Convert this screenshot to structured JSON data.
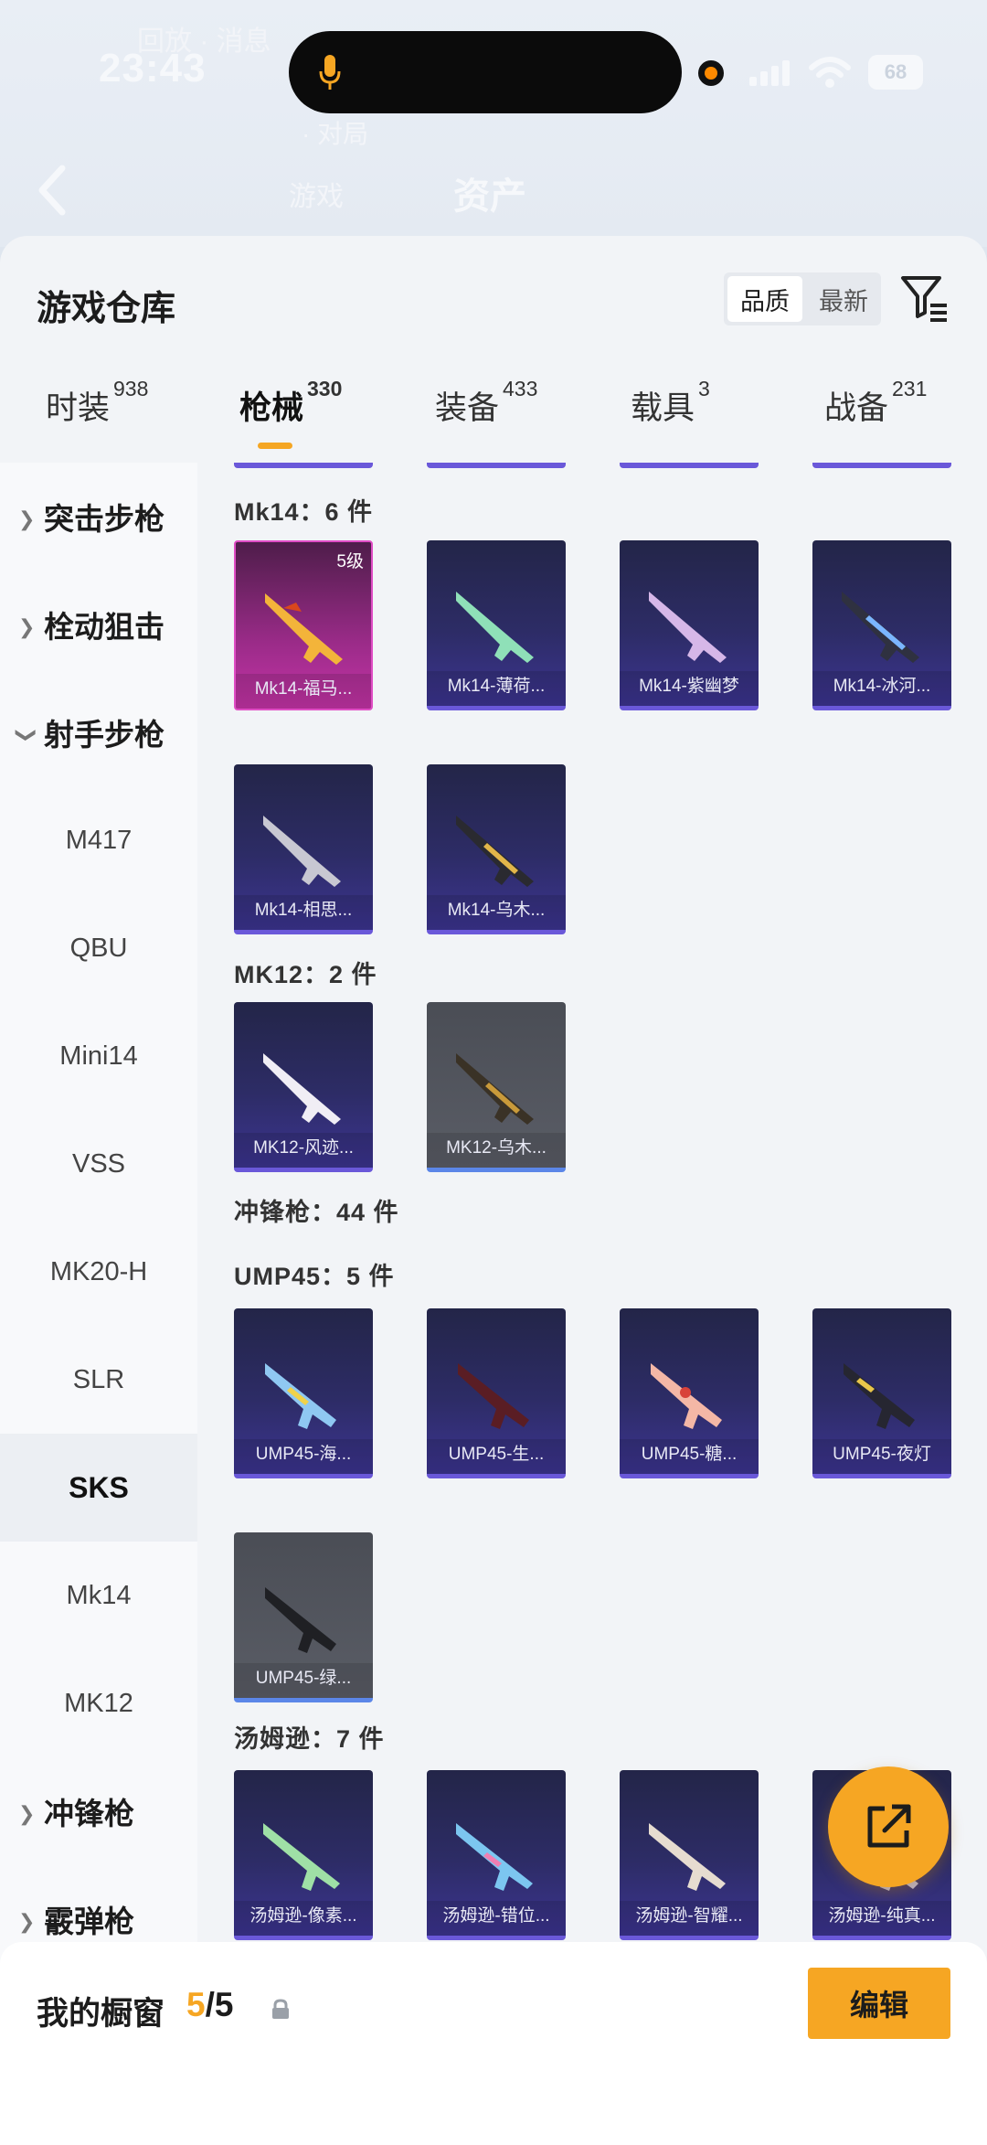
{
  "status_bar": {
    "time": "23:43",
    "battery": "68"
  },
  "background_app": {
    "faint_top": "回放 · 消息",
    "tabs": [
      "游戏",
      "资产"
    ],
    "sub": "· 对局",
    "active_tab": "资产"
  },
  "sheet": {
    "title": "游戏仓库",
    "sort": {
      "quality": "品质",
      "latest": "最新"
    }
  },
  "tabs": [
    {
      "label": "时装",
      "count": "938"
    },
    {
      "label": "枪械",
      "count": "330"
    },
    {
      "label": "装备",
      "count": "433"
    },
    {
      "label": "载具",
      "count": "3"
    },
    {
      "label": "战备",
      "count": "231"
    }
  ],
  "sidebar": {
    "items": [
      {
        "label": "突击步枪",
        "kind": "group",
        "expanded": false
      },
      {
        "label": "栓动狙击",
        "kind": "group",
        "expanded": false
      },
      {
        "label": "射手步枪",
        "kind": "group",
        "expanded": true
      },
      {
        "label": "M417",
        "kind": "sub"
      },
      {
        "label": "QBU",
        "kind": "sub"
      },
      {
        "label": "Mini14",
        "kind": "sub"
      },
      {
        "label": "VSS",
        "kind": "sub"
      },
      {
        "label": "MK20-H",
        "kind": "sub"
      },
      {
        "label": "SLR",
        "kind": "sub"
      },
      {
        "label": "SKS",
        "kind": "sub",
        "selected": true
      },
      {
        "label": "Mk14",
        "kind": "sub"
      },
      {
        "label": "MK12",
        "kind": "sub"
      },
      {
        "label": "冲锋枪",
        "kind": "group",
        "expanded": false
      },
      {
        "label": "霰弹枪",
        "kind": "group",
        "expanded": false
      }
    ]
  },
  "groups": {
    "mk14": {
      "title": "Mk14：6 件",
      "items": [
        {
          "name": "Mk14-福马...",
          "level": "5级",
          "rarity": "pink"
        },
        {
          "name": "Mk14-薄荷...",
          "rarity": "purple"
        },
        {
          "name": "Mk14-紫幽梦",
          "rarity": "purple"
        },
        {
          "name": "Mk14-冰河...",
          "rarity": "purple"
        },
        {
          "name": "Mk14-相思...",
          "rarity": "purple"
        },
        {
          "name": "Mk14-乌木...",
          "rarity": "purple"
        }
      ]
    },
    "mk12": {
      "title": "MK12：2 件",
      "items": [
        {
          "name": "MK12-风迹...",
          "rarity": "purple"
        },
        {
          "name": "MK12-乌木...",
          "rarity": "gray"
        }
      ]
    },
    "smg_header": "冲锋枪：44 件",
    "ump45": {
      "title": "UMP45：5 件",
      "items": [
        {
          "name": "UMP45-海...",
          "rarity": "purple"
        },
        {
          "name": "UMP45-生...",
          "rarity": "purple"
        },
        {
          "name": "UMP45-糖...",
          "rarity": "purple"
        },
        {
          "name": "UMP45-夜灯",
          "rarity": "purple"
        },
        {
          "name": "UMP45-绿...",
          "rarity": "gray"
        }
      ]
    },
    "thompson": {
      "title": "汤姆逊：7 件",
      "items": [
        {
          "name": "汤姆逊-像素...",
          "rarity": "purple"
        },
        {
          "name": "汤姆逊-错位...",
          "rarity": "purple"
        },
        {
          "name": "汤姆逊-智耀...",
          "rarity": "purple"
        },
        {
          "name": "汤姆逊-纯真...",
          "rarity": "purple"
        }
      ]
    }
  },
  "bottom_bar": {
    "label": "我的橱窗",
    "current": "5",
    "separator": "/",
    "total": "5",
    "edit": "编辑"
  },
  "colors": {
    "accent": "#f6a623",
    "purple_card": "#2d2c66",
    "pink_card": "#c434a6",
    "gray_card": "#5a5d66"
  },
  "icons": [
    "microphone-icon",
    "signal-icon",
    "wifi-icon",
    "battery-icon",
    "back-arrow-icon",
    "filter-icon",
    "chevron-right-icon",
    "chevron-down-icon",
    "share-icon",
    "lock-icon"
  ]
}
